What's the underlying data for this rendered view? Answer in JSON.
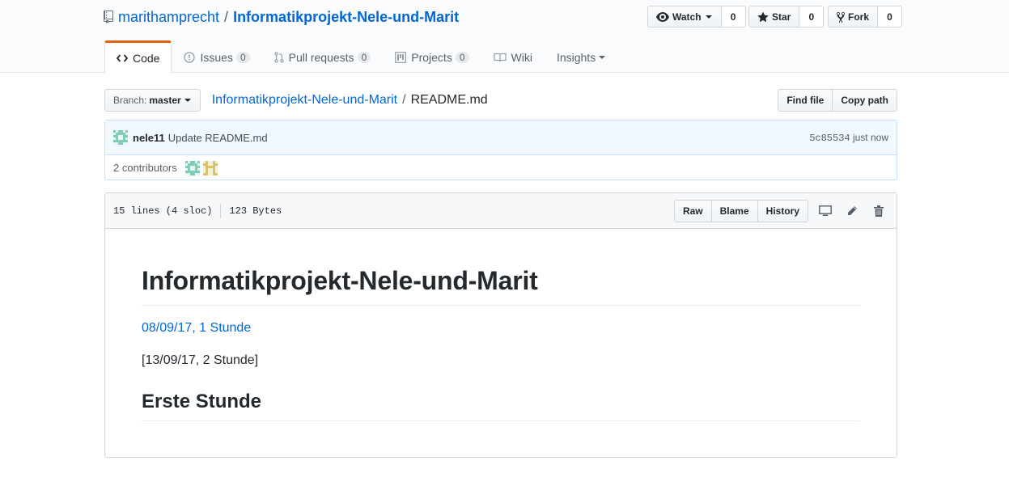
{
  "repo": {
    "owner": "marithamprecht",
    "separator": "/",
    "name": "Informatikprojekt-Nele-und-Marit"
  },
  "actions": {
    "watch": {
      "label": "Watch",
      "count": "0"
    },
    "star": {
      "label": "Star",
      "count": "0"
    },
    "fork": {
      "label": "Fork",
      "count": "0"
    }
  },
  "tabs": [
    {
      "label": "Code",
      "icon": "code-icon"
    },
    {
      "label": "Issues",
      "count": "0",
      "icon": "issue-icon"
    },
    {
      "label": "Pull requests",
      "count": "0",
      "icon": "pull-request-icon"
    },
    {
      "label": "Projects",
      "count": "0",
      "icon": "project-icon"
    },
    {
      "label": "Wiki",
      "icon": "book-icon"
    },
    {
      "label": "Insights",
      "icon": "caret-down-icon"
    }
  ],
  "file_nav": {
    "branch_label": "Branch:",
    "branch_name": "master",
    "crumb_repo": "Informatikprojekt-Nele-und-Marit",
    "crumb_sep": "/",
    "crumb_file": "README.md",
    "find_file": "Find file",
    "copy_path": "Copy path"
  },
  "commit": {
    "author": "nele11",
    "message": "Update README.md",
    "sha": "5c85534",
    "time": "just now",
    "contributors": "2 contributors"
  },
  "file": {
    "lines": "15 lines (4 sloc)",
    "size": "123 Bytes",
    "raw": "Raw",
    "blame": "Blame",
    "history": "History"
  },
  "readme": {
    "h1": "Informatikprojekt-Nele-und-Marit",
    "link_text": "08/09/17, 1 Stunde",
    "paragraph": "[13/09/17, 2 Stunde]",
    "h2": "Erste Stunde"
  },
  "colors": {
    "link": "#0366d6",
    "tab_accent": "#e36209",
    "commit_bg": "#f1f8ff"
  }
}
